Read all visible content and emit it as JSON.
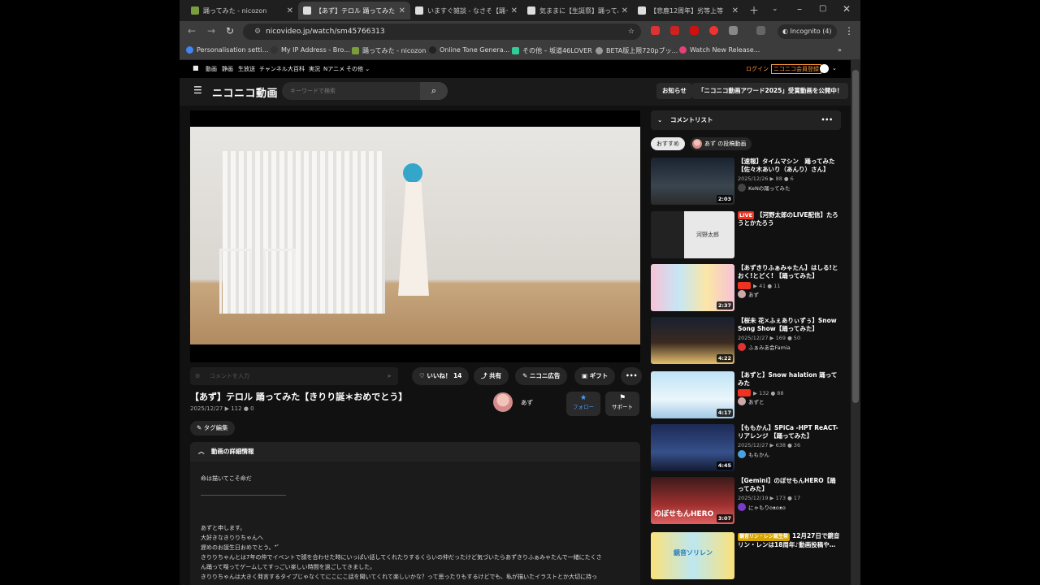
{
  "browser": {
    "tabs": [
      {
        "label": "踊ってみた - nicozon",
        "active": false
      },
      {
        "label": "【あず】テロル 踊ってみた",
        "active": true
      },
      {
        "label": "いますぐ雑談 - なさそ【踊って",
        "active": false
      },
      {
        "label": "気ままに【生誕祭】踊ってみ",
        "active": false
      },
      {
        "label": "【悲鹿12周年】劣等上等",
        "active": false
      }
    ],
    "url": "nicovideo.jp/watch/sm45766313",
    "incognito_label": "Incognito (4)",
    "bookmarks": [
      "Personalisation setti...",
      "My IP Address - Bro...",
      "踊ってみた - nicozon",
      "Online Tone Genera...",
      "その他 – 坂道46LOVER",
      "BETA版上限720pブッ...",
      "Watch New Release..."
    ]
  },
  "topnav": {
    "items": [
      "動画",
      "静画",
      "生放送",
      "チャンネル",
      "大百科",
      "実況",
      "Nアニメ",
      "その他 ⌄"
    ],
    "login": "ログイン",
    "register": "ニコニコ会員登録"
  },
  "header": {
    "logo": "ニコニコ動画",
    "search_placeholder": "キーワードで検索",
    "notice_label": "お知らせ",
    "banner_label": "「ニコニコ動画アワード2025」受賞動画を公開中！"
  },
  "actions": {
    "comment_placeholder": "コメントを入力",
    "like_label": "いいね！ 14",
    "share_label": "共有",
    "ad_label": "ニコニ広告",
    "gift_label": "ギフト",
    "more_label": "•••"
  },
  "video": {
    "title": "【あず】テロル 踊ってみた【きりり誕＊おめでとう】",
    "date": "2025/12/27",
    "views": "112",
    "comments": "0",
    "owner": "あず",
    "follow_label": "フォロー",
    "support_label": "サポート",
    "tag_edit_label": "タグ編集",
    "details_label": "動画の詳細情報",
    "description": [
      "命は描いてこそ命だ",
      "＿＿＿＿＿＿＿＿＿＿＿＿＿＿＿",
      "",
      "あずと申します。",
      "大好きなきりりちゃんへ",
      "遅めのお誕生日おめでとう。*ﾟ",
      "きりりちゃんとは7年の仲でイベントで顔を合わせた時にいっぱい話してくれたりするくらいの仲だったけど気づいたらあずきりふぁみゃたんで一緒にたくさ",
      "ん踊って喋ってゲームしてすっごい楽しい時間を過ごしてきました。",
      "きりりちゃんは大きく発言するタイプじゃなくてにこにこ話を聞いてくれて楽しいかな？って思ったりもするけどでも、私が描いたイラストとか大切に持っ"
    ]
  },
  "sidebar": {
    "header_label": "コメントリスト",
    "chips": [
      "おすすめ",
      "あず の投稿動画"
    ],
    "items": [
      {
        "title": "【速報】タイムマシン　踊ってみた【佐々木あいり（あんり）さん】",
        "meta": "2025/12/26 ▶ 88 ● 6",
        "owner": "KeNの踊ってみた",
        "duration": "2:03"
      },
      {
        "live": "LIVE",
        "title": "【河野太郎のLIVE配信】たろうとかたろう",
        "meta": "",
        "owner": "",
        "duration": "",
        "thumb_text": "河野太郎"
      },
      {
        "title": "【あずきりふぁみゃたん】はしる!とおく!とどく! 【踊ってみた】",
        "meta": "▶ 41 ● 11",
        "owner": "あず",
        "duration": "2:37"
      },
      {
        "title": "【桜未 花×ふぇありぃずぅ】Snow Song Show【踊ってみた】",
        "meta": "2025/12/27 ▶ 169 ● 50",
        "owner": "ふぁみあ会Famia",
        "duration": "4:22"
      },
      {
        "title": "【あずと】Snow halation 踊ってみた",
        "meta": "▶ 132 ● 88",
        "owner": "あずと",
        "duration": "4:17"
      },
      {
        "title": "【ももかん】SPiCa -HPT ReACT- リアレンジ 【踊ってみた】",
        "meta": "2025/12/27 ▶ 638 ● 36",
        "owner": "ももかん",
        "duration": "4:45"
      },
      {
        "title": "【Gemini】のぼせもんHERO【踊ってみた】",
        "meta": "2025/12/19 ▶ 173 ● 17",
        "owner": "にゃもりoᴥoᴥo",
        "duration": "3:07",
        "thumb_text": "のぼせもんHERO"
      },
      {
        "badge": "鏡音リン・レン誕生祭",
        "title": "12月27日で鏡音リン・レンは18周年♪動画投稿や…",
        "meta": "",
        "owner": "",
        "duration": "",
        "thumb_text": "鏡音ソリレン"
      }
    ]
  }
}
